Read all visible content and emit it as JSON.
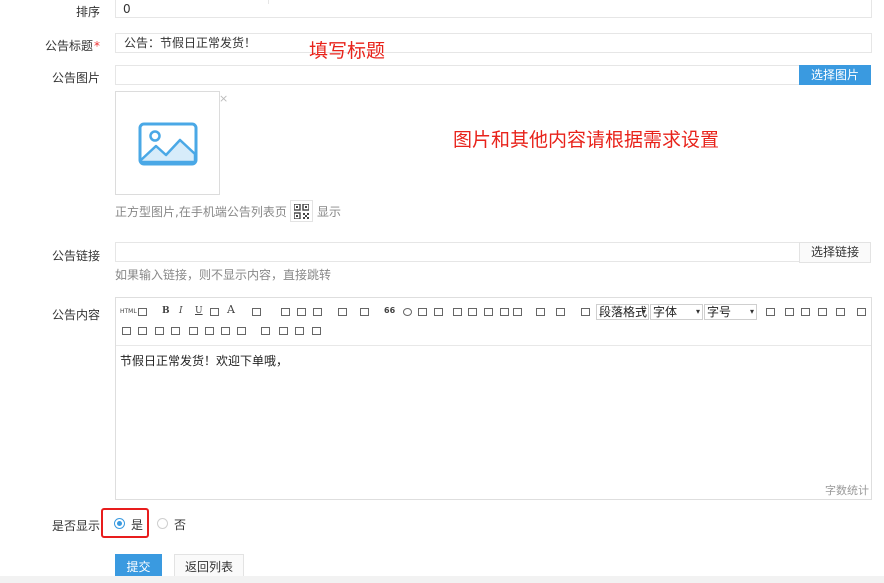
{
  "form": {
    "sort": {
      "label": "排序",
      "value": "0"
    },
    "title": {
      "label": "公告标题",
      "required_mark": "*",
      "value": "公告：节假日正常发货！"
    },
    "image": {
      "label": "公告图片",
      "value": "",
      "select_button": "选择图片",
      "remove_glyph": "×",
      "hint_prefix": "正方型图片,在手机端公告列表页",
      "hint_suffix": "显示"
    },
    "link": {
      "label": "公告链接",
      "value": "",
      "select_button": "选择链接",
      "hint": "如果输入链接，则不显示内容，直接跳转"
    },
    "content": {
      "label": "公告内容",
      "body": "节假日正常发货！欢迎下单哦，",
      "word_count_label": "字数统计",
      "toolbar": {
        "paragraph_format": "段落格式",
        "font_family": "字体",
        "font_size": "字号",
        "html_label": "HTML",
        "bold": "B",
        "italic": "I",
        "underline": "U",
        "font_color": "A",
        "quote": "66"
      }
    },
    "display": {
      "label": "是否显示",
      "options": [
        {
          "label": "是",
          "checked": true
        },
        {
          "label": "否",
          "checked": false
        }
      ]
    },
    "submit_button": "提交",
    "back_button": "返回列表"
  },
  "annotations": {
    "title_note": "填写标题",
    "image_note": "图片和其他内容请根据需求设置"
  },
  "colors": {
    "accent": "#3a9ae0",
    "annotation_red": "#e8231b",
    "highlight_box": "#e81d1d"
  }
}
